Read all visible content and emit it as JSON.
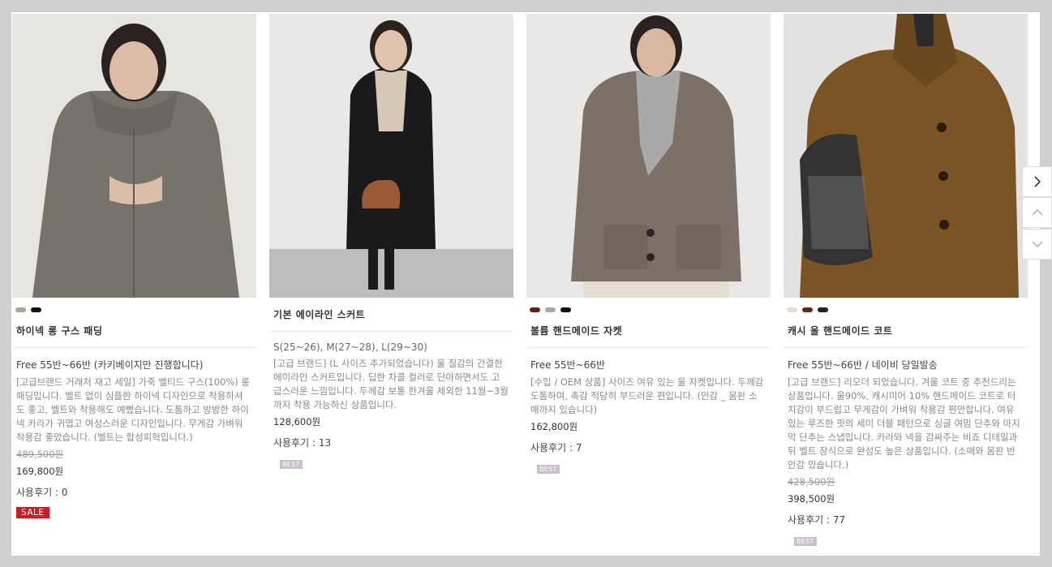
{
  "colors": {
    "background": "#cfcfcf",
    "sale_badge": "#c81d25",
    "best_badge": "#c9bfca"
  },
  "products": [
    {
      "swatches": [
        "#a9a396",
        "#111111"
      ],
      "name": "하이넥 롱 구스 패딩",
      "size": "Free 55반~66반 (카키베이지만 진행합니다)",
      "description": "[고급브랜드 거래처 재고 세일] 가죽 벨티드 구스(100%) 롱 패딩입니다. 벨트 없이 심플한 하이넥 디자인으로 착용하셔도 좋고, 벨트와 착용해도 예뻤습니다. 도톰하고 방방한 하이넥 카라가 귀엽고 여성스러운 디자인입니다. 무게감 가벼워 착용감 좋았습니다. (벨트는 합성피혁입니다.)",
      "original_price": "489,500원",
      "price": "169,800원",
      "reviews": "사용후기 : 0",
      "badge": "SALE"
    },
    {
      "swatches": [],
      "name": "기본 에이라인 스커트",
      "size": "S(25~26), M(27~28), L(29~30)",
      "description": "[고급 브랜드] (L 사이즈 추가되었습니다) 울 질감의 간결한 에이라인 스커트입니다. 딥한 차콜 컬러로 단아하면서도 고급스러운 느낌입니다. 두께감 보통 한겨울 제외한 11월~3월까지 착용 가능하신 상품입니다.",
      "original_price": "",
      "price": "128,600원",
      "reviews": "사용후기 : 13",
      "badge": "BEST"
    },
    {
      "swatches": [
        "#5a2410",
        "#a8a8a8",
        "#111111"
      ],
      "name": "볼륨 핸드메이드 자켓",
      "size": "Free 55반~66반",
      "description": "[수입 / OEM 상품] 사이즈 여유 있는 울 자켓입니다. 두께감 도톰하며, 촉감 적당히 부드러운 편입니다. (안감 _ 몸판 소매까지 있습니다)",
      "original_price": "",
      "price": "162,800원",
      "reviews": "사용후기 : 7",
      "badge": "BEST"
    },
    {
      "swatches": [
        "#e8dccb",
        "#5a2e14",
        "#222222"
      ],
      "name": "캐시 울 핸드메이드 코트",
      "size": "Free 55반~66반 / 네이비 당일발송",
      "description": "[고급 브랜드] 리오더 되었습니다. 겨울 코트 중 추천드리는 상품입니다. 울90%, 캐시미어 10% 핸드메이드 코트로 터치감이 부드럽고 무게감이 가벼워 착용감 편안합니다. 여유있는 루즈한 핏의 세미 더블 패턴으로 싱글 여밈 단추와 마지막 단추는 스냅입니다. 카라와 넥을 감싸주는 비죠 디테일과 뒤 벨트 장식으로 완성도 높은 상품입니다. (소매와 몸판 반 안감 있습니다.)",
      "original_price": "428,500원",
      "price": "398,500원",
      "reviews": "사용후기 : 77",
      "badge": "BEST"
    }
  ],
  "side_nav": {
    "next_icon": "chevron-right-icon",
    "up_icon": "chevron-up-icon",
    "down_icon": "chevron-down-icon"
  }
}
